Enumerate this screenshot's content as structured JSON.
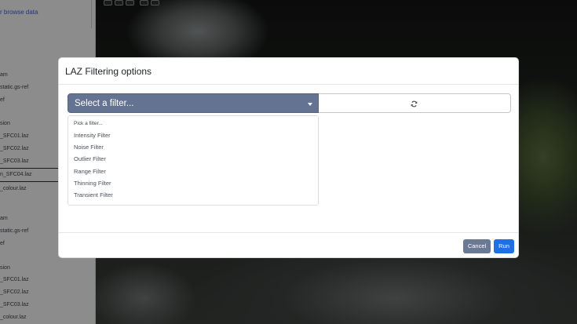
{
  "sidebar": {
    "browse_link": "r browse data",
    "items": [
      {
        "label": "am"
      },
      {
        "label": "static.gs-ref"
      },
      {
        "label": "ef"
      },
      {
        "label": "sion"
      },
      {
        "label": "_SFC01.laz"
      },
      {
        "label": "_SFC02.laz"
      },
      {
        "label": "_SFC03.laz"
      },
      {
        "label": "n_SFC04.laz"
      },
      {
        "label": "_colour.laz"
      },
      {
        "label": "am"
      },
      {
        "label": "static.gs-ref"
      },
      {
        "label": "ef"
      },
      {
        "label": "sion"
      },
      {
        "label": "_SFC01.laz"
      },
      {
        "label": "_SFC02.laz"
      },
      {
        "label": "_SFC03.laz"
      },
      {
        "label": "_colour.laz"
      }
    ]
  },
  "modal": {
    "title": "LAZ Filtering options",
    "select_label": "Select a filter...",
    "refresh_icon": "refresh-icon",
    "options": [
      "Pick a filter...",
      "Intensity Filter",
      "Noise Filter",
      "Outlier Filter",
      "Range Filter",
      "Thinning Filter",
      "Transient Filter"
    ],
    "cancel_label": "Cancel",
    "run_label": "Run"
  },
  "colors": {
    "select_bg": "#647391",
    "cancel_bg": "#6b7a94",
    "run_bg": "#1f6fe5"
  }
}
